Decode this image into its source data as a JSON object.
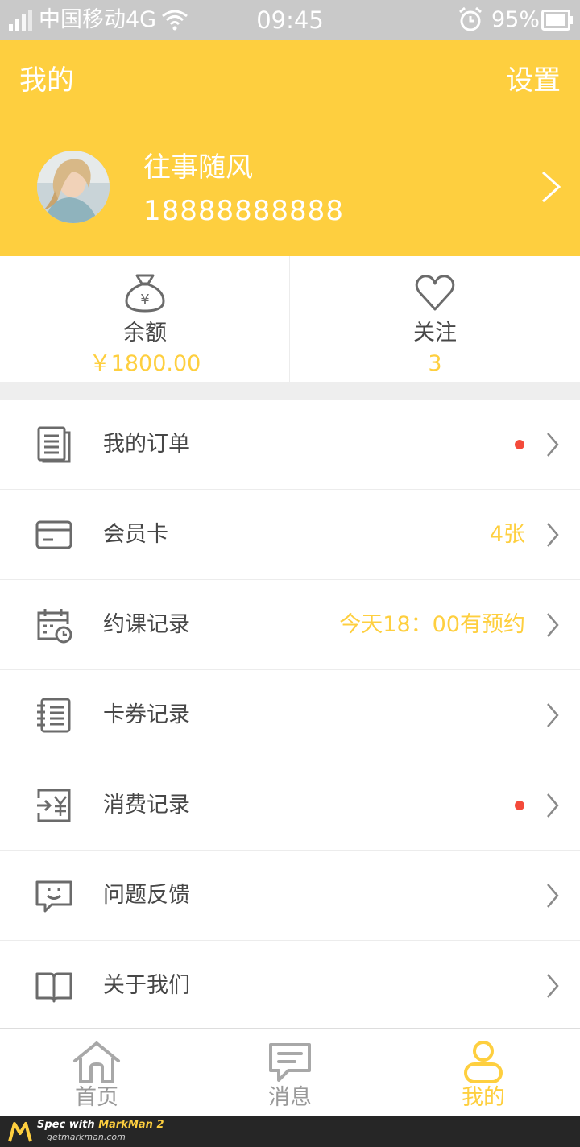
{
  "status_bar": {
    "carrier": "中国移动4G",
    "time": "09:45",
    "battery": "95%"
  },
  "header": {
    "title": "我的",
    "settings_label": "设置",
    "user_name": "往事随风",
    "phone": "18888888888"
  },
  "stats": [
    {
      "label": "余额",
      "value": "￥1800.00",
      "icon": "money-bag-icon"
    },
    {
      "label": "关注",
      "value": "3",
      "icon": "heart-icon"
    }
  ],
  "menu": [
    {
      "label": "我的订单",
      "value": "",
      "badge": true,
      "icon": "order-document-icon"
    },
    {
      "label": "会员卡",
      "value": "4张",
      "badge": false,
      "icon": "member-card-icon"
    },
    {
      "label": "约课记录",
      "value": "今天18：00有预约",
      "badge": false,
      "icon": "calendar-clock-icon"
    },
    {
      "label": "卡券记录",
      "value": "",
      "badge": false,
      "icon": "notebook-icon"
    },
    {
      "label": "消费记录",
      "value": "",
      "badge": true,
      "icon": "consumption-yuan-icon"
    },
    {
      "label": "问题反馈",
      "value": "",
      "badge": false,
      "icon": "feedback-chat-icon"
    },
    {
      "label": "关于我们",
      "value": "",
      "badge": false,
      "icon": "open-book-icon"
    }
  ],
  "tabs": [
    {
      "label": "首页",
      "icon": "home-icon",
      "active": false
    },
    {
      "label": "消息",
      "icon": "message-icon",
      "active": false
    },
    {
      "label": "我的",
      "icon": "person-icon",
      "active": true
    }
  ],
  "footer": {
    "spec_prefix": "Spec with ",
    "brand": "MarkMan 2",
    "url": "getmarkman.com"
  },
  "colors": {
    "accent": "#fecf3f",
    "text": "#474747",
    "badge": "#f44a3a",
    "header_text": "#ffffff"
  }
}
